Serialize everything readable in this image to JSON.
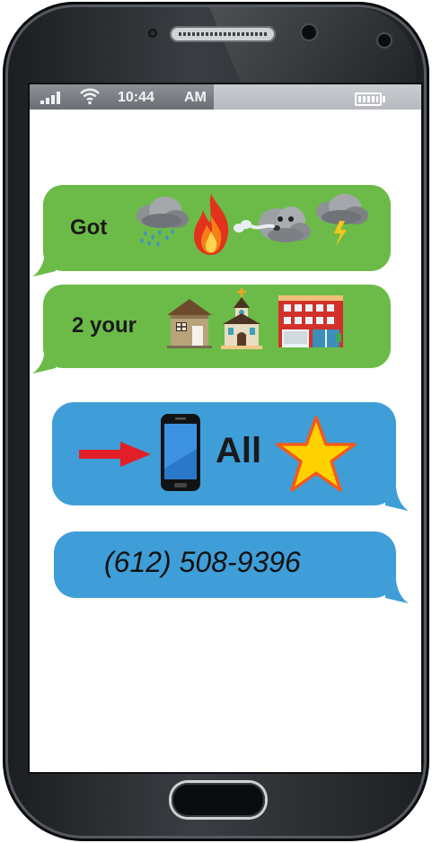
{
  "status_bar": {
    "time": "10:44",
    "ampm": "AM",
    "icons": [
      "signal-icon",
      "wifi-icon",
      "battery-icon"
    ]
  },
  "messages": [
    {
      "id": "msg1",
      "color": "#6cbb48",
      "text": "Got",
      "icons": [
        "rain-cloud-icon",
        "fire-icon",
        "wind-face-icon",
        "thunder-cloud-icon"
      ]
    },
    {
      "id": "msg2",
      "color": "#6cbb48",
      "text": "2 your",
      "icons": [
        "house-icon",
        "church-icon",
        "office-building-icon"
      ]
    },
    {
      "id": "msg3",
      "color": "#3f9ed8",
      "text": "All",
      "icons": [
        "right-arrow-icon",
        "smartphone-icon",
        "star-icon"
      ]
    },
    {
      "id": "msg4",
      "color": "#3f9ed8",
      "text": "(612) 508-9396",
      "icons": []
    }
  ],
  "colors": {
    "green_bubble": "#6cbb48",
    "blue_bubble": "#3f9ed8",
    "phone_body": "#2a2d31"
  }
}
